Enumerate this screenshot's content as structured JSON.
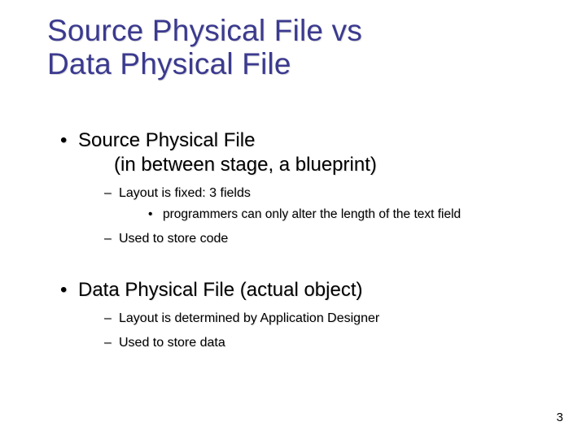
{
  "title_line1": "Source Physical File vs",
  "title_line2": "Data Physical File",
  "sections": [
    {
      "heading": "Source Physical File",
      "heading_cont": "(in between stage, a blueprint)",
      "items": [
        {
          "text": "Layout is fixed: 3 fields",
          "subitems": [
            "programmers can only alter the length of the text field"
          ]
        },
        {
          "text": "Used to store code"
        }
      ]
    },
    {
      "heading": "Data Physical File (actual object)",
      "items": [
        {
          "text": "Layout is determined by Application Designer"
        },
        {
          "text": "Used to store data"
        }
      ]
    }
  ],
  "page_number": "3"
}
